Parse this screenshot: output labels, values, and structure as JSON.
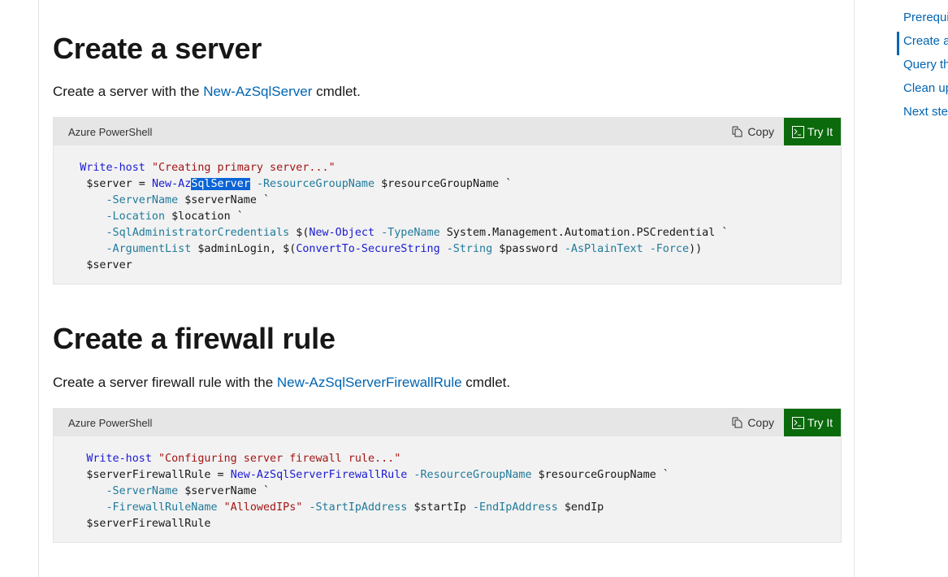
{
  "toc": {
    "items": [
      {
        "label": "Prerequi",
        "active": false
      },
      {
        "label": "Create a",
        "active": true
      },
      {
        "label": "Query th",
        "active": false
      },
      {
        "label": "Clean up",
        "active": false
      },
      {
        "label": "Next ste",
        "active": false
      }
    ]
  },
  "sections": [
    {
      "heading": "Create a server",
      "intro_before": "Create a server with the ",
      "intro_link": "New-AzSqlServer",
      "intro_after": " cmdlet.",
      "code": {
        "language": "Azure PowerShell",
        "copy_label": "Copy",
        "tryit_label": "Try It",
        "lines": [
          [
            [
              "plain",
              "    "
            ],
            [
              "cmd",
              "Write-host"
            ],
            [
              "plain",
              " "
            ],
            [
              "str",
              "\"Creating primary server...\""
            ]
          ],
          [
            [
              "plain",
              "     "
            ],
            [
              "var",
              "$server"
            ],
            [
              "plain",
              " = "
            ],
            [
              "cmd",
              "New-Az"
            ],
            [
              "sel",
              "SqlServer"
            ],
            [
              "plain",
              " "
            ],
            [
              "param",
              "-ResourceGroupName"
            ],
            [
              "plain",
              " "
            ],
            [
              "var",
              "$resourceGroupName"
            ],
            [
              "plain",
              " `"
            ]
          ],
          [
            [
              "plain",
              "        "
            ],
            [
              "param",
              "-ServerName"
            ],
            [
              "plain",
              " "
            ],
            [
              "var",
              "$serverName"
            ],
            [
              "plain",
              " `"
            ]
          ],
          [
            [
              "plain",
              "        "
            ],
            [
              "param",
              "-Location"
            ],
            [
              "plain",
              " "
            ],
            [
              "var",
              "$location"
            ],
            [
              "plain",
              " `"
            ]
          ],
          [
            [
              "plain",
              "        "
            ],
            [
              "param",
              "-SqlAdministratorCredentials"
            ],
            [
              "plain",
              " $("
            ],
            [
              "cmd",
              "New-Object"
            ],
            [
              "plain",
              " "
            ],
            [
              "param",
              "-TypeName"
            ],
            [
              "plain",
              " System.Management.Automation.PSCredential `"
            ]
          ],
          [
            [
              "plain",
              "        "
            ],
            [
              "param",
              "-ArgumentList"
            ],
            [
              "plain",
              " "
            ],
            [
              "var",
              "$adminLogin"
            ],
            [
              "plain",
              ", $("
            ],
            [
              "cmd",
              "ConvertTo-SecureString"
            ],
            [
              "plain",
              " "
            ],
            [
              "param",
              "-String"
            ],
            [
              "plain",
              " "
            ],
            [
              "var",
              "$password"
            ],
            [
              "plain",
              " "
            ],
            [
              "param",
              "-AsPlainText"
            ],
            [
              "plain",
              " "
            ],
            [
              "param",
              "-Force"
            ],
            [
              "plain",
              "))"
            ]
          ],
          [
            [
              "plain",
              "     "
            ],
            [
              "var",
              "$server"
            ]
          ]
        ]
      }
    },
    {
      "heading": "Create a firewall rule",
      "intro_before": "Create a server firewall rule with the ",
      "intro_link": "New-AzSqlServerFirewallRule",
      "intro_after": " cmdlet.",
      "code": {
        "language": "Azure PowerShell",
        "copy_label": "Copy",
        "tryit_label": "Try It",
        "lines": [
          [
            [
              "plain",
              "     "
            ],
            [
              "cmd",
              "Write-host"
            ],
            [
              "plain",
              " "
            ],
            [
              "str",
              "\"Configuring server firewall rule...\""
            ]
          ],
          [
            [
              "plain",
              "     "
            ],
            [
              "var",
              "$serverFirewallRule"
            ],
            [
              "plain",
              " = "
            ],
            [
              "cmd",
              "New-AzSqlServerFirewallRule"
            ],
            [
              "plain",
              " "
            ],
            [
              "param",
              "-ResourceGroupName"
            ],
            [
              "plain",
              " "
            ],
            [
              "var",
              "$resourceGroupName"
            ],
            [
              "plain",
              " `"
            ]
          ],
          [
            [
              "plain",
              "        "
            ],
            [
              "param",
              "-ServerName"
            ],
            [
              "plain",
              " "
            ],
            [
              "var",
              "$serverName"
            ],
            [
              "plain",
              " `"
            ]
          ],
          [
            [
              "plain",
              "        "
            ],
            [
              "param",
              "-FirewallRuleName"
            ],
            [
              "plain",
              " "
            ],
            [
              "str",
              "\"AllowedIPs\""
            ],
            [
              "plain",
              " "
            ],
            [
              "param",
              "-StartIpAddress"
            ],
            [
              "plain",
              " "
            ],
            [
              "var",
              "$startIp"
            ],
            [
              "plain",
              " "
            ],
            [
              "param",
              "-EndIpAddress"
            ],
            [
              "plain",
              " "
            ],
            [
              "var",
              "$endIp"
            ]
          ],
          [
            [
              "plain",
              "     "
            ],
            [
              "var",
              "$serverFirewallRule"
            ]
          ]
        ]
      }
    }
  ],
  "colors": {
    "link": "#0065b3",
    "tryit_bg": "#0b6a0b",
    "selection": "#0a64d6"
  }
}
